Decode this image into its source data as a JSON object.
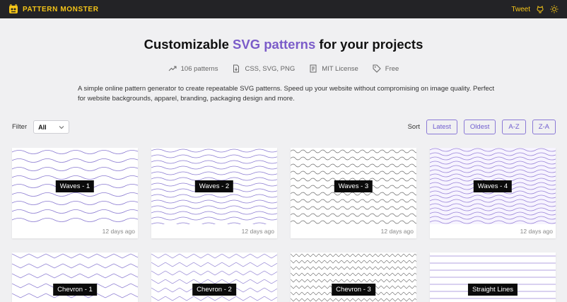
{
  "brand": {
    "name": "PATTERN MONSTER"
  },
  "topbar": {
    "tweet_label": "Tweet",
    "github_icon": "github-icon",
    "theme_icon": "sun-icon"
  },
  "hero": {
    "title_prefix": "Customizable ",
    "title_highlight": "SVG patterns",
    "title_suffix": " for your projects"
  },
  "stats": [
    {
      "icon": "trending-up-icon",
      "label": "106 patterns"
    },
    {
      "icon": "file-download-icon",
      "label": "CSS, SVG, PNG"
    },
    {
      "icon": "license-icon",
      "label": "MIT License"
    },
    {
      "icon": "price-tag-icon",
      "label": "Free"
    }
  ],
  "description": "A simple online pattern generator to create repeatable SVG patterns. Speed up your website without compromising on image quality. Perfect for website backgrounds, apparel, branding, packaging design and more.",
  "filter": {
    "label": "Filter",
    "value": "All"
  },
  "sort": {
    "label": "Sort",
    "options": [
      "Latest",
      "Oldest",
      "A-Z",
      "Z-A"
    ]
  },
  "colors": {
    "accent": "#7b5cc9",
    "topbar": "#232326",
    "brand": "#f5c518"
  },
  "patterns": [
    {
      "name": "Waves - 1",
      "age": "12 days ago"
    },
    {
      "name": "Waves - 2",
      "age": "12 days ago"
    },
    {
      "name": "Waves - 3",
      "age": "12 days ago"
    },
    {
      "name": "Waves - 4",
      "age": "12 days ago"
    },
    {
      "name": "Chevron - 1",
      "age": ""
    },
    {
      "name": "Chevron - 2",
      "age": ""
    },
    {
      "name": "Chevron - 3",
      "age": ""
    },
    {
      "name": "Straight Lines",
      "age": ""
    }
  ]
}
